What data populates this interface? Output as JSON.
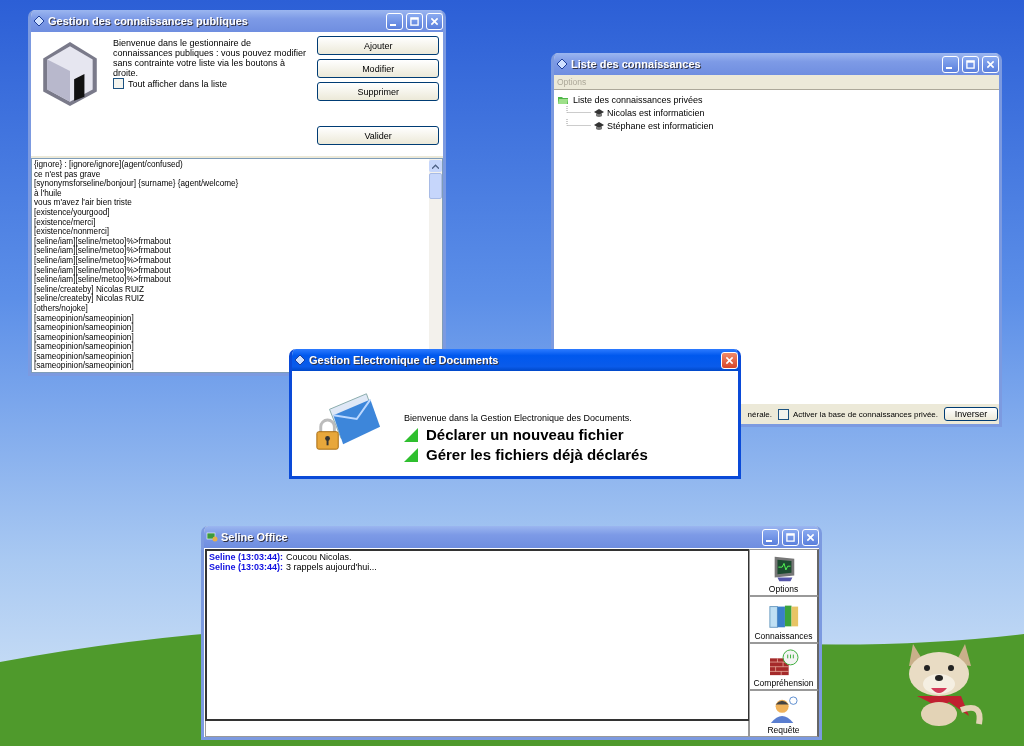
{
  "knowledge_window": {
    "title": "Gestion des connaissances publiques",
    "active": false,
    "intro": "Bienvenue dans le gestionnaire de connaissances publiques : vous pouvez modifier sans contrainte votre liste via les boutons à droite.",
    "show_all": {
      "label": "Tout afficher dans la liste",
      "checked": false
    },
    "buttons": [
      "Ajouter",
      "Modifier",
      "Supprimer",
      "Valider"
    ],
    "entries": [
      "{ignore} : [ignore/ignore](agent/confused)",
      "ce n'est pas grave",
      "[synonymsforseline/bonjour] {surname} {agent/welcome}",
      "à l'huile",
      "vous m'avez l'air bien triste",
      "[existence/yourgood]",
      "[existence/merci]",
      "[existence/nonmerci]",
      "[seline/iam][seline/metoo]%>frmabout",
      "[seline/iam][seline/metoo]%>frmabout",
      "[seline/iam][seline/metoo]%>frmabout",
      "[seline/iam][seline/metoo]%>frmabout",
      "[seline/iam][seline/metoo]%>frmabout",
      "[seline/createby] Nicolas RUIZ",
      "[seline/createby] Nicolas RUIZ",
      "[others/nojoke]",
      "[sameopinion/sameopinion]",
      "[sameopinion/sameopinion]",
      "[sameopinion/sameopinion]",
      "[sameopinion/sameopinion]",
      "[sameopinion/sameopinion]",
      "[sameopinion/sameopinion]"
    ]
  },
  "list_window": {
    "title": "Liste des connaissances",
    "active": false,
    "menu": [
      {
        "label": "Options",
        "disabled": true
      }
    ],
    "tree": {
      "label": "Liste des connaissances privées",
      "children": [
        {
          "label": "Nicolas est informaticien"
        },
        {
          "label": "Stéphane est informaticien"
        }
      ]
    },
    "status_text": "nérale.",
    "private_base": {
      "label": "Activer la base de connaissances privée.",
      "checked": false
    },
    "button": "Inverser"
  },
  "ged_window": {
    "title": "Gestion Electronique de Documents",
    "active": true,
    "intro": "Bienvenue dans la Gestion Electronique des Documents.",
    "actions": [
      "Déclarer un nouveau fichier",
      "Gérer les fichiers déjà déclarés"
    ]
  },
  "office_window": {
    "title": "Seline Office",
    "active": false,
    "messages": [
      {
        "sender": "Seline (13:03:44):",
        "text": "Coucou Nicolas."
      },
      {
        "sender": "Seline (13:03:44):",
        "text": "3 rappels aujourd'hui..."
      }
    ],
    "tools": [
      {
        "label": "Options",
        "kind": "monitor"
      },
      {
        "label": "Connaissances",
        "kind": "binders"
      },
      {
        "label": "Compréhension",
        "kind": "wall"
      },
      {
        "label": "Requête",
        "kind": "person"
      }
    ]
  }
}
